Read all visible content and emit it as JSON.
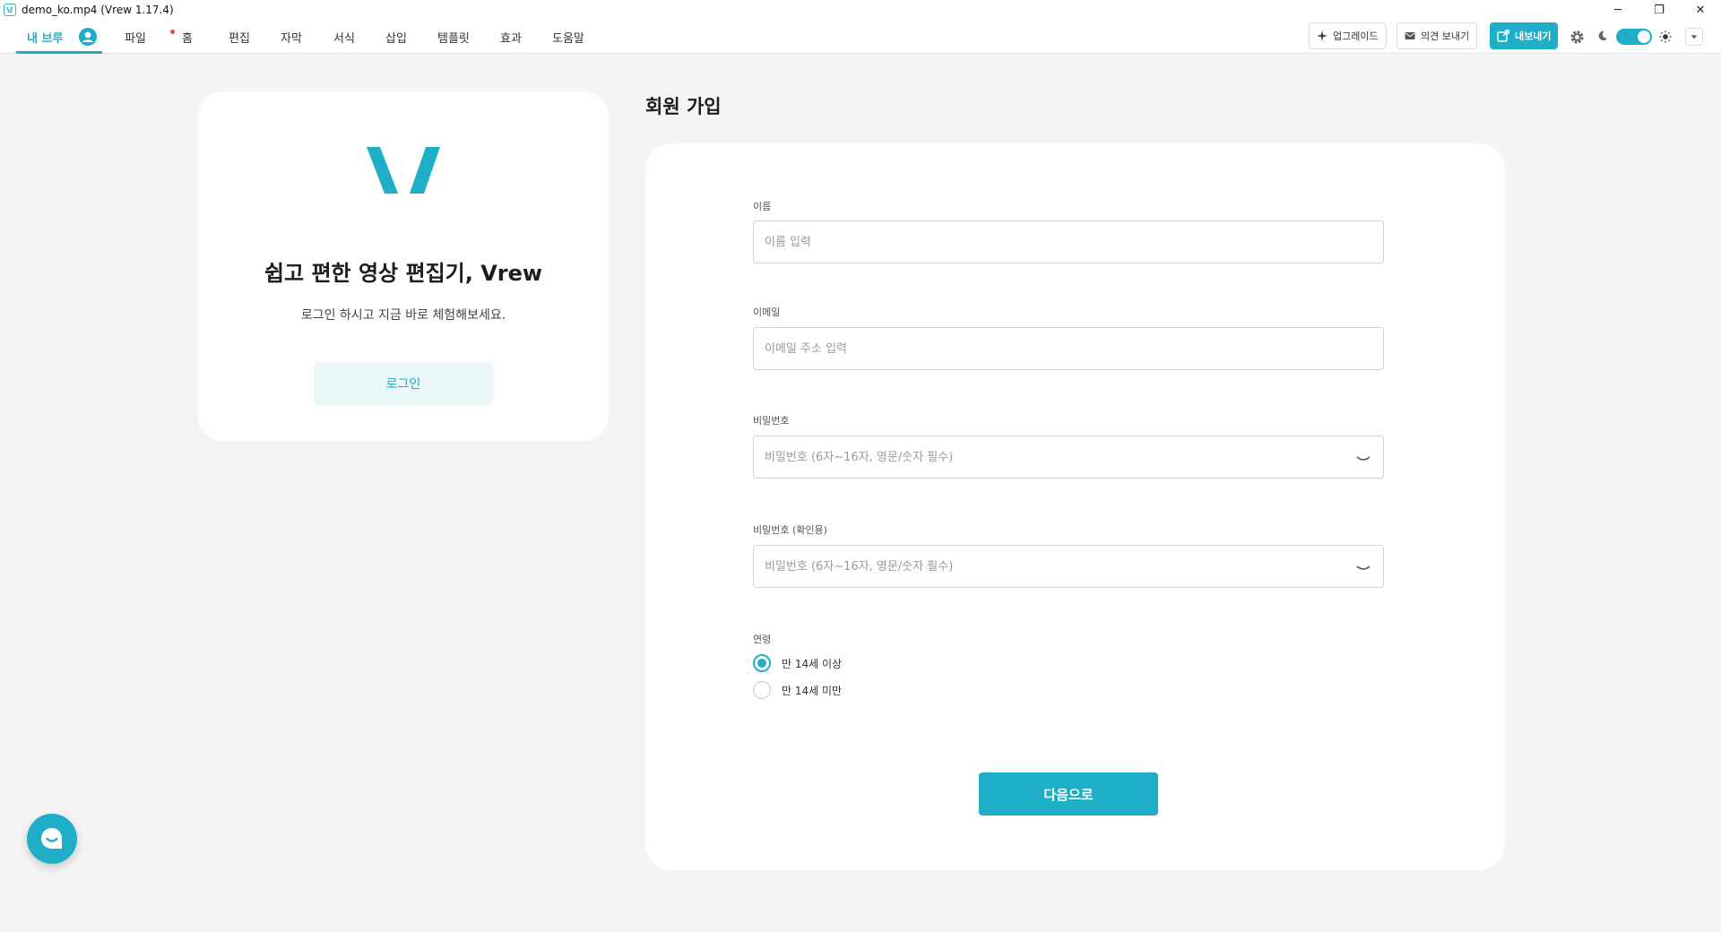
{
  "window": {
    "title": "demo_ko.mp4 (Vrew 1.17.4)",
    "minimize": "─",
    "restore": "❐",
    "close": "✕"
  },
  "menubar": {
    "tabs": [
      {
        "label": "내 브루"
      },
      {
        "label": "파일"
      },
      {
        "label": "홈"
      },
      {
        "label": "편집"
      },
      {
        "label": "자막"
      },
      {
        "label": "서식"
      },
      {
        "label": "삽입"
      },
      {
        "label": "템플릿"
      },
      {
        "label": "효과"
      },
      {
        "label": "도움말"
      }
    ],
    "upgrade_label": "업그레이드",
    "feedback_label": "의견 보내기",
    "export_label": "내보내기",
    "icons": [
      "settings-icon",
      "moon-icon",
      "sun-icon",
      "chevron-down-icon"
    ],
    "accent_color": "#1faec7"
  },
  "left_card": {
    "tagline": "쉽고 편한 영상 편집기, Vrew",
    "subtext": "로그인 하시고 지금 바로 체험해보세요.",
    "login_label": "로그인"
  },
  "signup": {
    "title": "회원 가입",
    "name_label": "이름",
    "name_placeholder": "이름 입력",
    "email_label": "이메일",
    "email_placeholder": "이메일 주소 입력",
    "password_label": "비밀번호",
    "password_placeholder": "비밀번호 (6자~16자, 영문/숫자 필수)",
    "password_confirm_label": "비밀번호 (확인용)",
    "password_confirm_placeholder": "비밀번호 (6자~16자, 영문/숫자 필수)",
    "age_label": "연령",
    "age_options": [
      {
        "label": "만 14세 이상",
        "selected": true
      },
      {
        "label": "만 14세 미만",
        "selected": false
      }
    ],
    "next_label": "다음으로"
  }
}
